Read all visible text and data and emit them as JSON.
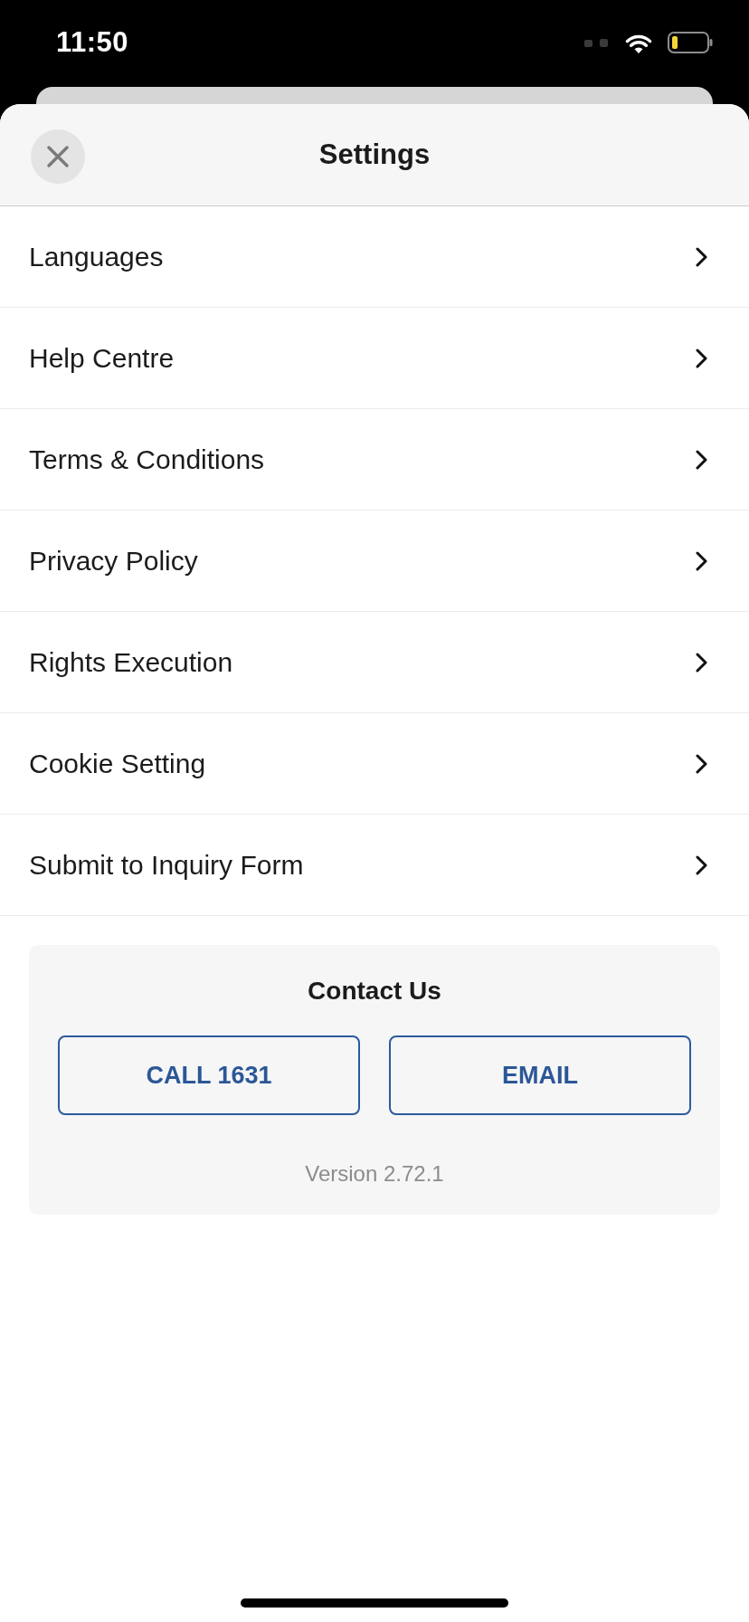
{
  "status_bar": {
    "time": "11:50"
  },
  "header": {
    "title": "Settings"
  },
  "menu": {
    "items": [
      {
        "label": "Languages"
      },
      {
        "label": "Help Centre"
      },
      {
        "label": "Terms & Conditions"
      },
      {
        "label": "Privacy Policy"
      },
      {
        "label": "Rights Execution"
      },
      {
        "label": "Cookie Setting"
      },
      {
        "label": "Submit to Inquiry Form"
      }
    ]
  },
  "contact": {
    "title": "Contact Us",
    "buttons": [
      {
        "label": "CALL 1631"
      },
      {
        "label": "EMAIL"
      }
    ],
    "version": "Version 2.72.1"
  }
}
